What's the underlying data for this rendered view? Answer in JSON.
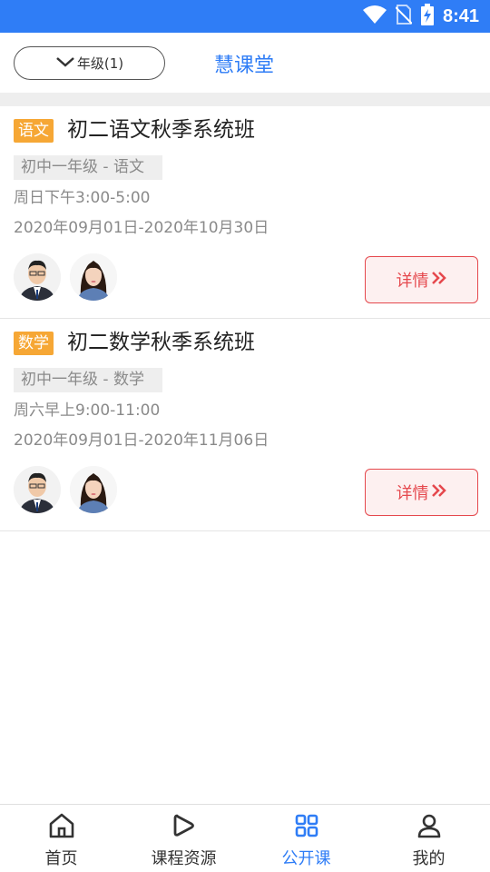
{
  "status_bar": {
    "time": "8:41"
  },
  "header": {
    "grade_filter": "年级(1)",
    "title": "慧课堂"
  },
  "courses": [
    {
      "subject": "语文",
      "title": "初二语文秋季系统班",
      "grade": "初中一年级 - 语文",
      "schedule": "周日下午3:00-5:00",
      "dates": "2020年09月01日-2020年10月30日",
      "detail_label": "详情"
    },
    {
      "subject": "数学",
      "title": "初二数学秋季系统班",
      "grade": "初中一年级 - 数学",
      "schedule": "周六早上9:00-11:00",
      "dates": "2020年09月01日-2020年11月06日",
      "detail_label": "详情"
    }
  ],
  "tabs": [
    {
      "label": "首页",
      "icon": "home-icon"
    },
    {
      "label": "课程资源",
      "icon": "play-icon"
    },
    {
      "label": "公开课",
      "icon": "grid-icon",
      "active": true
    },
    {
      "label": "我的",
      "icon": "user-icon"
    }
  ],
  "colors": {
    "primary": "#2f7df6",
    "subject_tag": "#f6a735",
    "detail": "#e5484d"
  }
}
